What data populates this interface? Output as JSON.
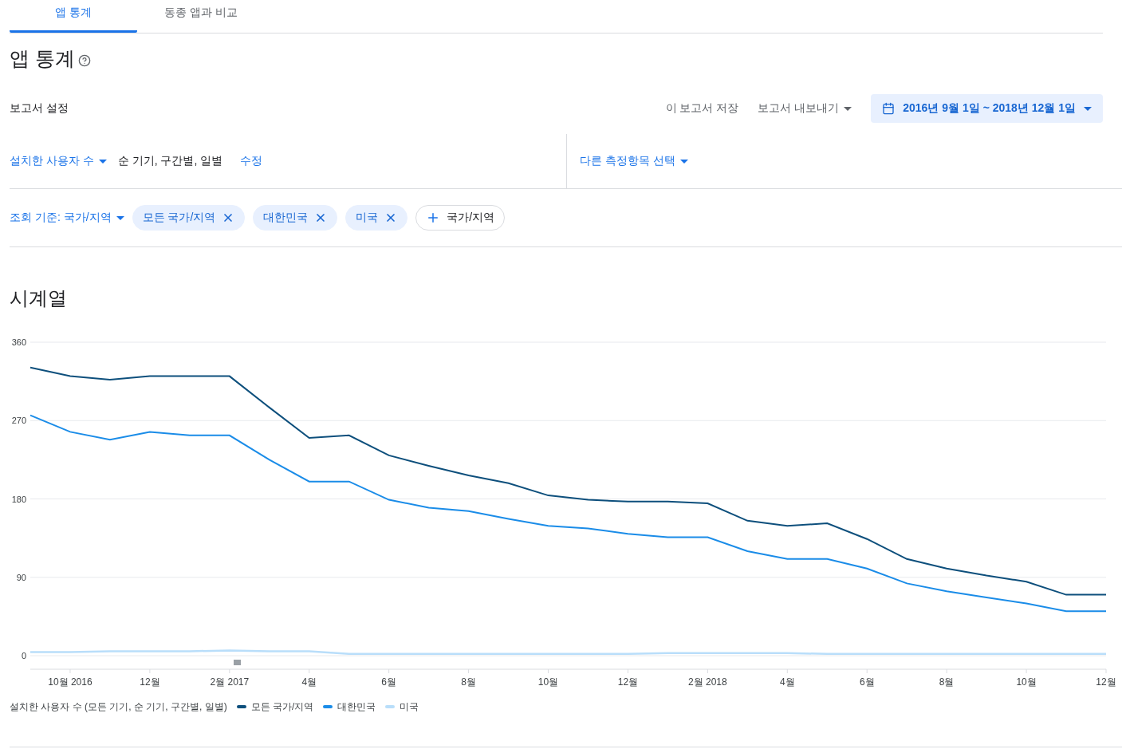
{
  "tabs": [
    {
      "label": "앱 통계",
      "selected": true
    },
    {
      "label": "동종 앱과 비교",
      "selected": false
    }
  ],
  "title": "앱 통계",
  "report_settings": {
    "label": "보고서 설정",
    "save": "이 보고서 저장",
    "export": "보고서 내보내기",
    "date_range": "2016년 9월 1일 ~ 2018년 12월 1일"
  },
  "metric": {
    "name": "설치한 사용자 수",
    "details": "순 기기, 구간별, 일별",
    "edit": "수정",
    "other_metric": "다른 측정항목 선택"
  },
  "filter": {
    "dimension": "조회 기준: 국가/지역",
    "chips": [
      {
        "label": "모든 국가/지역",
        "kind": "removable"
      },
      {
        "label": "대한민국",
        "kind": "removable"
      },
      {
        "label": "미국",
        "kind": "removable"
      },
      {
        "label": "국가/지역",
        "kind": "add"
      }
    ]
  },
  "section_title": "시계열",
  "chart": {
    "legend_caption": "설치한 사용자 수 (모든 기기, 순 기기, 구간별, 일별)",
    "chart_data": {
      "type": "line",
      "categories": [
        null,
        "10월 2016",
        null,
        "12월",
        null,
        "2월 2017",
        null,
        "4월",
        null,
        "6월",
        null,
        "8월",
        null,
        "10월",
        null,
        "12월",
        null,
        "2월 2018",
        null,
        "4월",
        null,
        "6월",
        null,
        "8월",
        null,
        "10월",
        null,
        "12월"
      ],
      "ylim": [
        0,
        360
      ],
      "grid": true,
      "yticks": [
        0,
        90,
        180,
        270,
        360
      ],
      "series": [
        {
          "name": "모든 국가/지역",
          "color": "#0d4f7c",
          "values": [
            331,
            321,
            317,
            321,
            321,
            321,
            285,
            250,
            253,
            230,
            218,
            207,
            198,
            184,
            179,
            177,
            177,
            175,
            155,
            149,
            152,
            134,
            111,
            100,
            92,
            85,
            70,
            70
          ]
        },
        {
          "name": "대한민국",
          "color": "#1a8ce8",
          "values": [
            276,
            257,
            248,
            257,
            253,
            253,
            225,
            200,
            200,
            179,
            170,
            166,
            157,
            149,
            146,
            140,
            136,
            136,
            120,
            111,
            111,
            100,
            83,
            74,
            67,
            60,
            51,
            51
          ]
        },
        {
          "name": "미국",
          "color": "#b9defa",
          "values": [
            4,
            4,
            5,
            5,
            5,
            6,
            5,
            5,
            2,
            2,
            2,
            2,
            2,
            2,
            2,
            2,
            3,
            3,
            3,
            3,
            2,
            2,
            2,
            2,
            2,
            2,
            2,
            2
          ]
        }
      ]
    }
  }
}
